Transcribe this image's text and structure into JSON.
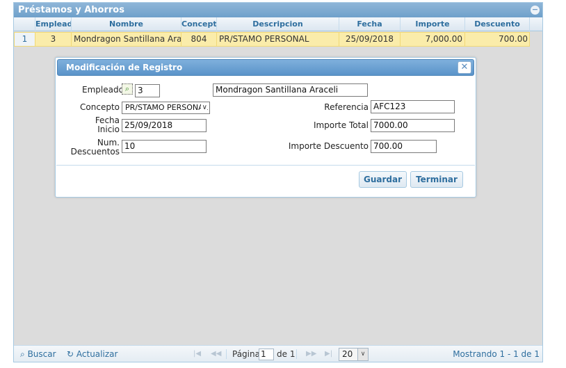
{
  "panel": {
    "title": "Préstamos y Ahorros"
  },
  "grid": {
    "columns": [
      "Empleado",
      "Nombre",
      "Concepto",
      "Descripcion",
      "Fecha",
      "Importe",
      "Descuento"
    ],
    "rows": [
      {
        "num": "1",
        "empleado": "3",
        "nombre": "Mondragon Santillana Araceli",
        "concepto": "804",
        "descripcion": "PR/STAMO PERSONAL",
        "fecha": "25/09/2018",
        "importe": "7,000.00",
        "descuento": "700.00"
      }
    ]
  },
  "dialog": {
    "title": "Modificación de Registro",
    "close_icon": "close-icon",
    "fields": {
      "empleado": {
        "label": "Empleado",
        "value": "3",
        "name_value": "Mondragon Santillana Araceli"
      },
      "concepto": {
        "label": "Concepto",
        "value": "PR/STAMO PERSONAL"
      },
      "fecha_inicio": {
        "label_1": "Fecha",
        "label_2": "Inicio",
        "value": "25/09/2018"
      },
      "num_descuentos": {
        "label_1": "Num.",
        "label_2": "Descuentos",
        "value": "10"
      },
      "referencia": {
        "label": "Referencia",
        "value": "AFC123"
      },
      "importe_total": {
        "label": "Importe Total",
        "value": "7000.00"
      },
      "importe_descuento": {
        "label": "Importe Descuento",
        "value": "700.00"
      }
    },
    "buttons": {
      "save": "Guardar",
      "finish": "Terminar"
    }
  },
  "pager": {
    "search": "Buscar",
    "refresh": "Actualizar",
    "page_label": "Página",
    "page_value": "1",
    "of_label": "de 1",
    "page_size": "20",
    "showing": "Mostrando 1 - 1 de 1"
  },
  "colors": {
    "accent": "#5a93c9",
    "selected_row": "#faecaa",
    "header_text": "#2e6e9e"
  }
}
